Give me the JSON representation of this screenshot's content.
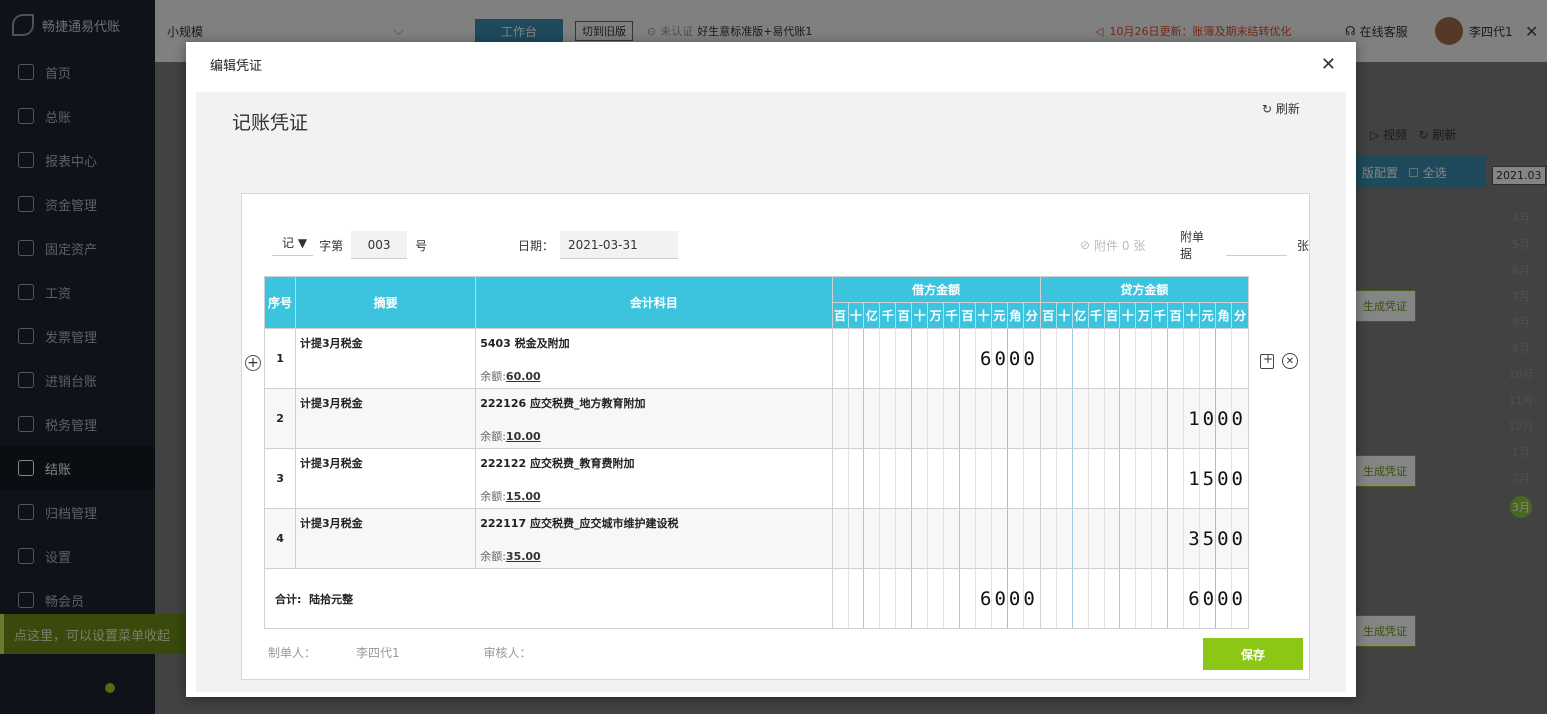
{
  "app": {
    "name": "畅捷通易代账"
  },
  "sidebar": {
    "items": [
      {
        "label": "首页"
      },
      {
        "label": "总账"
      },
      {
        "label": "报表中心"
      },
      {
        "label": "资金管理"
      },
      {
        "label": "固定资产"
      },
      {
        "label": "工资"
      },
      {
        "label": "发票管理"
      },
      {
        "label": "进销台账"
      },
      {
        "label": "税务管理"
      },
      {
        "label": "结账"
      },
      {
        "label": "归档管理"
      },
      {
        "label": "设置"
      },
      {
        "label": "畅会员"
      }
    ],
    "active_index": 9,
    "tip": "点这里，可以设置菜单收起"
  },
  "topbar": {
    "company": "小规模",
    "workbench": "工作台",
    "old_version": "切到旧版",
    "cert_status": "未认证",
    "edition": "好生意标准版+易代账1",
    "notice": "10月26日更新：账簿及期末结转优化",
    "service": "在线客服",
    "user": "李四代1"
  },
  "right_panel": {
    "video": "视频",
    "refresh": "刷新",
    "config": "版配置",
    "select_all": "全选",
    "period": "2021.03",
    "months": [
      "4月",
      "5月",
      "6月",
      "7月",
      "8月",
      "9月",
      "10月",
      "11月",
      "12月",
      "1月",
      "2月",
      "3月"
    ],
    "year_badge": "2021",
    "gen_voucher": "生成凭证"
  },
  "modal": {
    "title": "编辑凭证",
    "heading": "记账凭证",
    "refresh": "刷新",
    "voucher_type": "记",
    "word_prefix": "字第",
    "number": "003",
    "number_suffix": "号",
    "date_label": "日期：",
    "date_value": "2021-03-31",
    "attachments": "附件 0 张",
    "receipt_label": "附单据",
    "receipt_unit": "张",
    "columns": {
      "seq": "序号",
      "summary": "摘要",
      "account": "会计科目",
      "debit": "借方金额",
      "credit": "贷方金额"
    },
    "digit_units": [
      "百",
      "十",
      "亿",
      "千",
      "百",
      "十",
      "万",
      "千",
      "百",
      "十",
      "元",
      "角",
      "分"
    ],
    "rows": [
      {
        "seq": "1",
        "summary": "计提3月税金",
        "account": "5403 税金及附加",
        "balance_label": "余额:",
        "balance": "60.00",
        "debit": "6000",
        "credit": ""
      },
      {
        "seq": "2",
        "summary": "计提3月税金",
        "account": "222126 应交税费_地方教育附加",
        "balance_label": "余额:",
        "balance": "10.00",
        "debit": "",
        "credit": "1000"
      },
      {
        "seq": "3",
        "summary": "计提3月税金",
        "account": "222122 应交税费_教育费附加",
        "balance_label": "余额:",
        "balance": "15.00",
        "debit": "",
        "credit": "1500"
      },
      {
        "seq": "4",
        "summary": "计提3月税金",
        "account": "222117 应交税费_应交城市维护建设税",
        "balance_label": "余额:",
        "balance": "35.00",
        "debit": "",
        "credit": "3500"
      }
    ],
    "total_label": "合计:",
    "total_words": "陆拾元整",
    "total_debit": "6000",
    "total_credit": "6000",
    "maker_label": "制单人：",
    "maker": "李四代1",
    "reviewer_label": "审核人：",
    "save": "保存"
  },
  "colors": {
    "accent": "#3cc4de",
    "save": "#8cc716",
    "sidebar": "#1d2530"
  }
}
